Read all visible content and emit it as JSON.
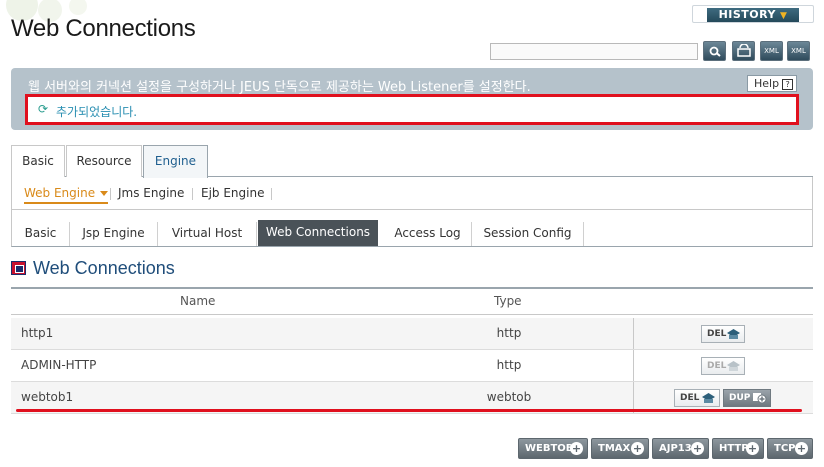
{
  "page": {
    "title": "Web Connections",
    "history_label": "HISTORY"
  },
  "toolbar": {
    "search_value": "",
    "buttons": [
      {
        "name": "search",
        "icon": "search-icon"
      },
      {
        "name": "refresh",
        "icon": "refresh-icon"
      },
      {
        "name": "export-xml",
        "icon": "xml-export-icon",
        "label": "XML"
      },
      {
        "name": "import-xml",
        "icon": "xml-import-icon",
        "label": "XML"
      }
    ]
  },
  "info": {
    "description": "웹 서버와의 커넥션 설정을 구성하거나 JEUS 단독으로 제공하는 Web Listener를 설정한다.",
    "help_label": "Help",
    "message": "추가되었습니다."
  },
  "tabs": {
    "top": [
      {
        "label": "Basic",
        "active": false
      },
      {
        "label": "Resource",
        "active": false
      },
      {
        "label": "Engine",
        "active": true
      }
    ],
    "sub": [
      {
        "label": "Web Engine",
        "active": true
      },
      {
        "label": "Jms Engine",
        "active": false
      },
      {
        "label": "Ejb Engine",
        "active": false
      }
    ],
    "third": [
      {
        "label": "Basic",
        "active": false
      },
      {
        "label": "Jsp Engine",
        "active": false
      },
      {
        "label": "Virtual Host",
        "active": false
      },
      {
        "label": "Web Connections",
        "active": true
      },
      {
        "label": "Access Log",
        "active": false
      },
      {
        "label": "Session Config",
        "active": false
      }
    ]
  },
  "section": {
    "title": "Web Connections"
  },
  "table": {
    "columns": [
      "Name",
      "Type"
    ],
    "rows": [
      {
        "name": "http1",
        "type": "http",
        "del": "DEL",
        "del_enabled": true
      },
      {
        "name": "ADMIN-HTTP",
        "type": "http",
        "del": "DEL",
        "del_enabled": false
      },
      {
        "name": "webtob1",
        "type": "webtob",
        "del": "DEL",
        "del_enabled": true,
        "dup": "DUP"
      }
    ]
  },
  "add_buttons": [
    "WEBTOB",
    "TMAX",
    "AJP13",
    "HTTP",
    "TCP"
  ],
  "colors": {
    "accent_red": "#e0101e",
    "title_blue": "#1f4d7a",
    "active_orange": "#d98a1a",
    "message_teal": "#2a8fb2"
  }
}
